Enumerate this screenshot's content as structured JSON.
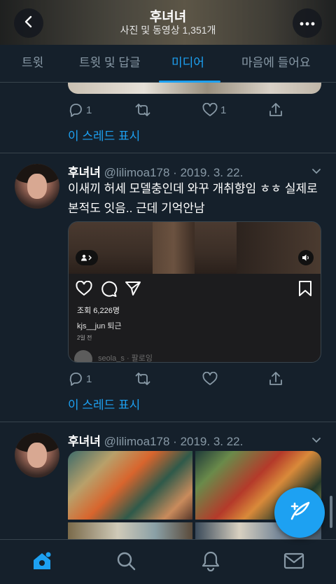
{
  "header": {
    "title": "후녀녀",
    "subtitle": "사진 및 동영상 1,351개",
    "back_icon": "chevron-left-icon",
    "more_icon": "more-horizontal-icon"
  },
  "tabs": [
    {
      "label": "트윗",
      "active": false
    },
    {
      "label": "트윗 및 답글",
      "active": false
    },
    {
      "label": "미디어",
      "active": true
    },
    {
      "label": "마음에 들어요",
      "active": false
    }
  ],
  "accent_color": "#1da1f2",
  "tweets": [
    {
      "actions": {
        "reply_count": "1",
        "retweet_count": "",
        "like_count": "1"
      },
      "thread_label": "이 스레드 표시"
    },
    {
      "name": "후녀녀",
      "meta": "@lilimoa178 · 2019. 3. 22.",
      "text": "이새끼 허세 모델충인데 와꾸 개취향임 ㅎㅎ 실제로 본적도 잇음.. 근데 기억안남",
      "embed": {
        "views": "조회 6,226명",
        "caption": "kjs__jun 퇴근",
        "date": "2일 전",
        "comment": "seola_s · 팔로잉"
      },
      "actions": {
        "reply_count": "1",
        "retweet_count": "",
        "like_count": ""
      },
      "thread_label": "이 스레드 표시"
    },
    {
      "name": "후녀녀",
      "meta": "@lilimoa178 · 2019. 3. 22."
    }
  ],
  "bottom_nav": [
    {
      "icon": "home-icon",
      "active": true
    },
    {
      "icon": "search-icon",
      "active": false
    },
    {
      "icon": "bell-icon",
      "active": false
    },
    {
      "icon": "mail-icon",
      "active": false
    }
  ],
  "fab_icon": "compose-tweet-icon"
}
